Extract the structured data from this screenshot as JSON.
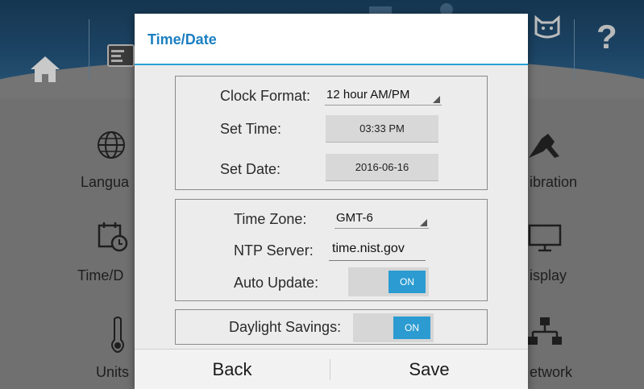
{
  "background": {
    "help_glyph": "?",
    "tiles": [
      {
        "label": "Langua",
        "icon": "globe-icon"
      },
      {
        "label": "Time/D",
        "icon": "calendar-clock-icon"
      },
      {
        "label": "Units",
        "icon": "thermometer-icon"
      },
      {
        "label": "ibration",
        "icon": "calibration-icon"
      },
      {
        "label": "isplay",
        "icon": "monitor-icon"
      },
      {
        "label": "etwork",
        "icon": "network-icon"
      }
    ]
  },
  "dialog": {
    "title": "Time/Date",
    "clock_format": {
      "label": "Clock Format:",
      "value": "12 hour AM/PM"
    },
    "set_time": {
      "label": "Set Time:",
      "value": "03:33 PM"
    },
    "set_date": {
      "label": "Set Date:",
      "value": "2016-06-16"
    },
    "time_zone": {
      "label": "Time Zone:",
      "value": "GMT-6"
    },
    "ntp_server": {
      "label": "NTP Server:",
      "value": "time.nist.gov"
    },
    "auto_update": {
      "label": "Auto Update:",
      "state": "ON"
    },
    "daylight_savings": {
      "label": "Daylight Savings:",
      "state": "ON"
    },
    "back_label": "Back",
    "save_label": "Save"
  },
  "colors": {
    "accent": "#2b9bd1",
    "title": "#1b7fc1",
    "header_bar": "#1c4465"
  }
}
